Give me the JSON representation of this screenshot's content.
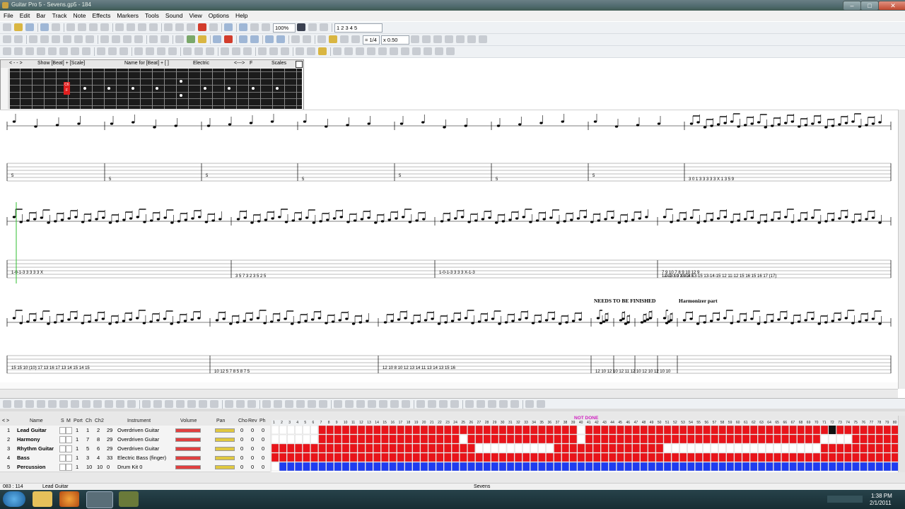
{
  "window": {
    "title": "Guitar Pro 5 - Sevens.gp5 - 184"
  },
  "menu": [
    "File",
    "Edit",
    "Bar",
    "Track",
    "Note",
    "Effects",
    "Markers",
    "Tools",
    "Sound",
    "View",
    "Options",
    "Help"
  ],
  "toolbar": {
    "zoom": "100%",
    "page_buttons": "1 2 3 4 5",
    "speed": "x 0.50",
    "tempo": "= 1/4"
  },
  "fretboard": {
    "header": [
      "< - - >",
      "Show [Beat] + [Scale]",
      "Name for [Beat] + [ ]",
      "Electric",
      "<--->",
      "F",
      "Scales"
    ],
    "selected_marker": "C6\nF"
  },
  "score": {
    "annotation_1": "NEEDS TO BE FINISHED",
    "annotation_2": "Harmonizer part",
    "row1_tabs": [
      "5",
      "5",
      "5",
      "5",
      "5",
      "5",
      "5",
      "3 0 1 3  3 3 3 3  X 1 3  5 9"
    ],
    "row2_tabs": [
      "1-0-1-3  3  3  3  3 X",
      "3 5 7 3  2 3 5 2  5",
      "1-0-1-3  3  3  3  X-1-3",
      "1-0-1-3  3  3  3  3 X",
      "7 9 10 7  8 9 10 12 9",
      "12-13  10 13-14  13-15 13-14-15  12  11-12 15 16 15 16 17 (17)"
    ],
    "row3_tabs": [
      "15 15 10 (10)  17  13 16 17  13 14 15 14 15",
      "10 12  5 7 8  5 8 7 5",
      "12 10 8  10 12 13 14  11 13 14 13 15 16",
      "12 10 12 10 12  11 12 10 12 10 12 10 10"
    ]
  },
  "tracks": {
    "headers": [
      "Name",
      "S",
      "M",
      "Port",
      "Ch",
      "Ch2",
      "Instrument",
      "Volume",
      "Pan",
      "Cho",
      "Rev",
      "Ph"
    ],
    "rows": [
      {
        "num": "1",
        "name": "Lead Guitar",
        "port": "1",
        "ch": "1",
        "ch2": "2",
        "patch": "29",
        "instrument": "Overdriven Guitar",
        "cho": "0",
        "rev": "0",
        "ph": "0"
      },
      {
        "num": "2",
        "name": "Harmony",
        "port": "1",
        "ch": "7",
        "ch2": "8",
        "patch": "29",
        "instrument": "Overdriven Guitar",
        "cho": "0",
        "rev": "0",
        "ph": "0"
      },
      {
        "num": "3",
        "name": "Rhythm Guitar",
        "port": "1",
        "ch": "5",
        "ch2": "6",
        "patch": "29",
        "instrument": "Overdriven Guitar",
        "cho": "0",
        "rev": "0",
        "ph": "0"
      },
      {
        "num": "4",
        "name": "Bass",
        "port": "1",
        "ch": "3",
        "ch2": "4",
        "patch": "33",
        "instrument": "Electric Bass (finger)",
        "cho": "0",
        "rev": "0",
        "ph": "0"
      },
      {
        "num": "5",
        "name": "Percussion",
        "port": "1",
        "ch": "10",
        "ch2": "10",
        "patch": "0",
        "instrument": "Drum Kit 0",
        "cho": "0",
        "rev": "0",
        "ph": "0"
      }
    ],
    "marker": "NOT DONE",
    "colors": {
      "filled": "#e8141a",
      "drums": "#1f3cf0",
      "empty": "#ffffff"
    }
  },
  "status": {
    "bar": "083 : 114",
    "track": "Lead Guitar",
    "file": "Sevens"
  },
  "clock": {
    "time": "1:38 PM",
    "date": "2/1/2011"
  }
}
